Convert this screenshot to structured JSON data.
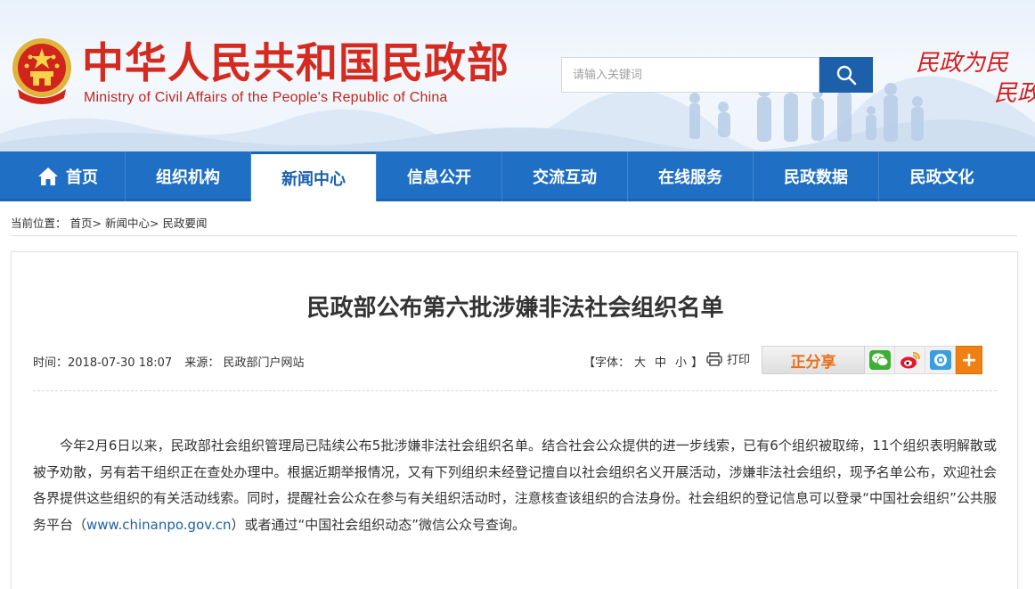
{
  "header": {
    "site_title": "中华人民共和国民政部",
    "site_subtitle": "Ministry of Civil Affairs of the People's Republic of China",
    "search_placeholder": "请输入关键词",
    "slogan_line1": "民政为民",
    "slogan_line2": "民政",
    "colors": {
      "title_red": "#d42a1f",
      "nav_blue": "#1f6fc4",
      "search_btn": "#1d5fa8"
    }
  },
  "nav": {
    "items": [
      {
        "label": "首页",
        "icon": "home-icon"
      },
      {
        "label": "组织机构"
      },
      {
        "label": "新闻中心",
        "active": true
      },
      {
        "label": "信息公开"
      },
      {
        "label": "交流互动"
      },
      {
        "label": "在线服务"
      },
      {
        "label": "民政数据"
      },
      {
        "label": "民政文化"
      }
    ]
  },
  "breadcrumb": {
    "prefix": "当前位置：",
    "items": [
      "首页>",
      "新闻中心>",
      "民政要闻"
    ]
  },
  "article": {
    "title": "民政部公布第六批涉嫌非法社会组织名单",
    "time_label": "时间：",
    "time": "2018-07-30 18:07",
    "source_label": "来源：",
    "source": "民政部门户网站",
    "font_label_open": "【字体：",
    "font_large": "大",
    "font_medium": "中",
    "font_small": "小",
    "font_label_close": "】",
    "print_label": "打印",
    "share_label": "正分享",
    "share_icons": [
      "wechat-icon",
      "weibo-icon",
      "qq-icon"
    ],
    "share_more": "+",
    "body_part1": "今年2月6日以来，民政部社会组织管理局已陆续公布5批涉嫌非法社会组织名单。结合社会公众提供的进一步线索，已有6个组织被取缔，11个组织表明解散或被予劝散，另有若干组织正在查处办理中。根据近期举报情况，又有下列组织未经登记擅自以社会组织名义开展活动，涉嫌非法社会组织，现予名单公布，欢迎社会各界提供这些组织的有关活动线索。同时，提醒社会公众在参与有关组织活动时，注意核查该组织的合法身份。社会组织的登记信息可以登录“中国社会组织”公共服务平台（",
    "body_link": "www.chinanpo.gov.cn",
    "body_part2": "）或者通过“中国社会组织动态”微信公众号查询。"
  }
}
